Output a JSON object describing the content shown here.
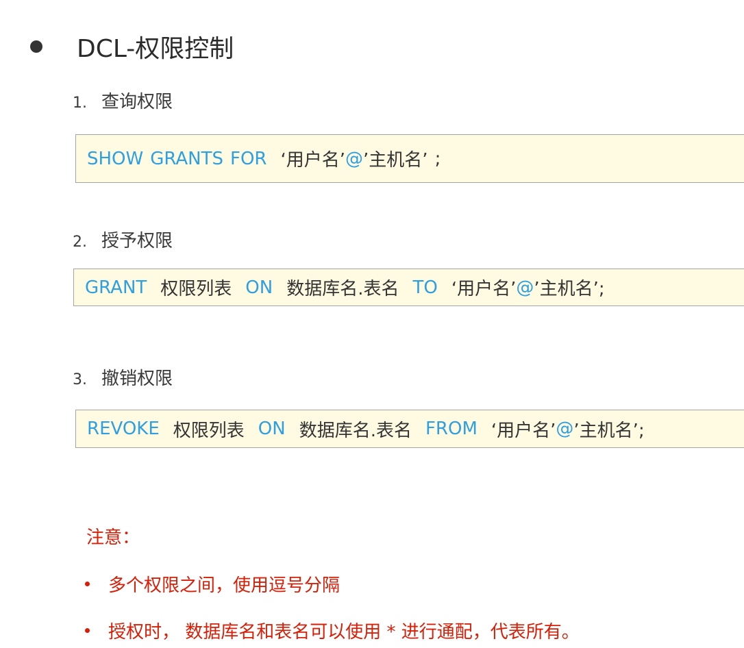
{
  "title": "DCL-权限控制",
  "sections": [
    {
      "number": "1.",
      "label": "查询权限",
      "code": [
        "SHOW",
        "GRANTS",
        "FOR",
        "‘用户名’",
        "@",
        "’主机名’",
        ";"
      ]
    },
    {
      "number": "2.",
      "label": "授予权限",
      "code": [
        "GRANT",
        "权限列表",
        "ON",
        "数据库名.表名",
        "TO",
        "‘用户名’",
        "@",
        "’主机名’;"
      ]
    },
    {
      "number": "3.",
      "label": "撤销权限",
      "code": [
        "REVOKE",
        "权限列表",
        "ON",
        "数据库名.表名",
        "FROM",
        "‘用户名’",
        "@",
        "’主机名’;"
      ]
    }
  ],
  "note": {
    "title": "注意：",
    "items": [
      "多个权限之间，使用逗号分隔",
      "授权时， 数据库名和表名可以使用 * 进行通配，代表所有。"
    ]
  },
  "colors": {
    "keyword": "#2e9fe0",
    "note": "#d81e06",
    "code_background": "#fefbe2"
  }
}
